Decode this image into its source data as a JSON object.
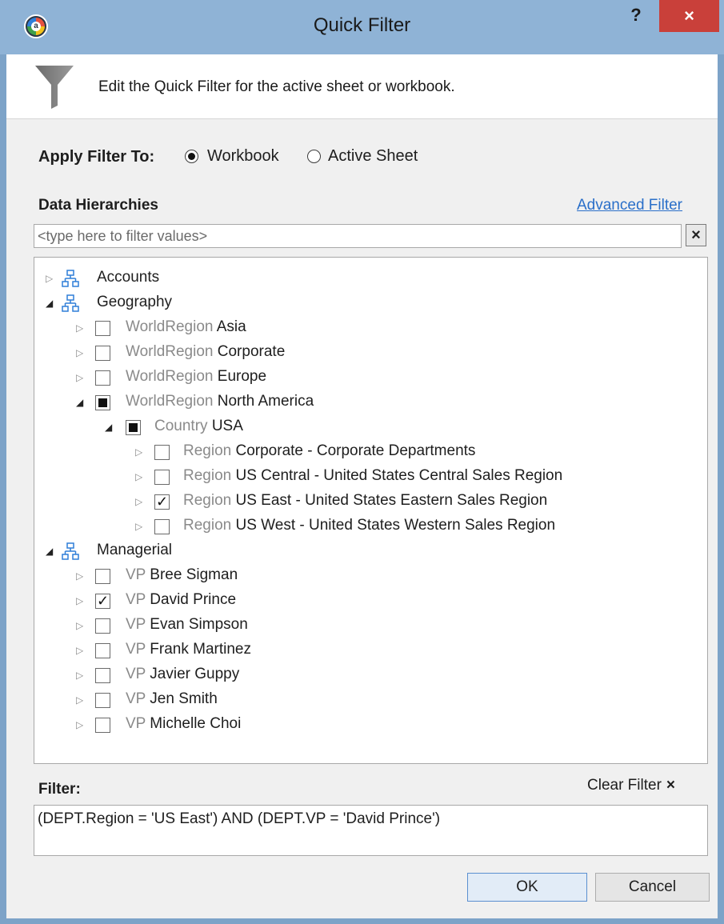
{
  "window": {
    "title": "Quick Filter",
    "help_label": "?",
    "close_label": "×"
  },
  "header": {
    "description": "Edit the Quick Filter for the active sheet or workbook."
  },
  "apply": {
    "label": "Apply Filter To:",
    "workbook_label": "Workbook",
    "sheet_label": "Active Sheet",
    "selected": "Workbook"
  },
  "hierarchies": {
    "label": "Data Hierarchies",
    "advanced_link": "Advanced Filter",
    "search_placeholder": "<type here to filter values>",
    "search_clear": "×"
  },
  "tree": {
    "accounts": {
      "name": "Accounts",
      "expanded": false
    },
    "geography": {
      "name": "Geography",
      "expanded": true,
      "regions": [
        {
          "level": "WorldRegion",
          "value": "Asia",
          "state": "unchecked",
          "expanded": false
        },
        {
          "level": "WorldRegion",
          "value": "Corporate",
          "state": "unchecked",
          "expanded": false
        },
        {
          "level": "WorldRegion",
          "value": "Europe",
          "state": "unchecked",
          "expanded": false
        },
        {
          "level": "WorldRegion",
          "value": "North America",
          "state": "partial",
          "expanded": true
        }
      ],
      "country": {
        "level": "Country",
        "value": "USA",
        "state": "partial",
        "expanded": true
      },
      "sub_regions": [
        {
          "level": "Region",
          "value": "Corporate - Corporate Departments",
          "state": "unchecked"
        },
        {
          "level": "Region",
          "value": "US Central - United States Central Sales Region",
          "state": "unchecked"
        },
        {
          "level": "Region",
          "value": "US East - United States Eastern Sales Region",
          "state": "checked"
        },
        {
          "level": "Region",
          "value": "US West - United States Western Sales Region",
          "state": "unchecked"
        }
      ]
    },
    "managerial": {
      "name": "Managerial",
      "expanded": true,
      "vps": [
        {
          "level": "VP",
          "value": "Bree Sigman",
          "state": "unchecked"
        },
        {
          "level": "VP",
          "value": "David Prince",
          "state": "checked"
        },
        {
          "level": "VP",
          "value": "Evan Simpson",
          "state": "unchecked"
        },
        {
          "level": "VP",
          "value": "Frank Martinez",
          "state": "unchecked"
        },
        {
          "level": "VP",
          "value": "Javier Guppy",
          "state": "unchecked"
        },
        {
          "level": "VP",
          "value": "Jen Smith",
          "state": "unchecked"
        },
        {
          "level": "VP",
          "value": "Michelle Choi",
          "state": "unchecked"
        }
      ]
    }
  },
  "filter": {
    "label": "Filter:",
    "clear_label": "Clear Filter",
    "clear_icon": "×",
    "expression": "(DEPT.Region = 'US East')  AND  (DEPT.VP = 'David Prince')"
  },
  "buttons": {
    "ok": "OK",
    "cancel": "Cancel"
  },
  "icons": {
    "app": "app-logo-icon",
    "funnel": "funnel-icon",
    "hierarchy": "hierarchy-icon",
    "check": "✓"
  },
  "colors": {
    "titlebar": "#8fb3d6",
    "close": "#c9403a",
    "link": "#2a6fc9"
  }
}
